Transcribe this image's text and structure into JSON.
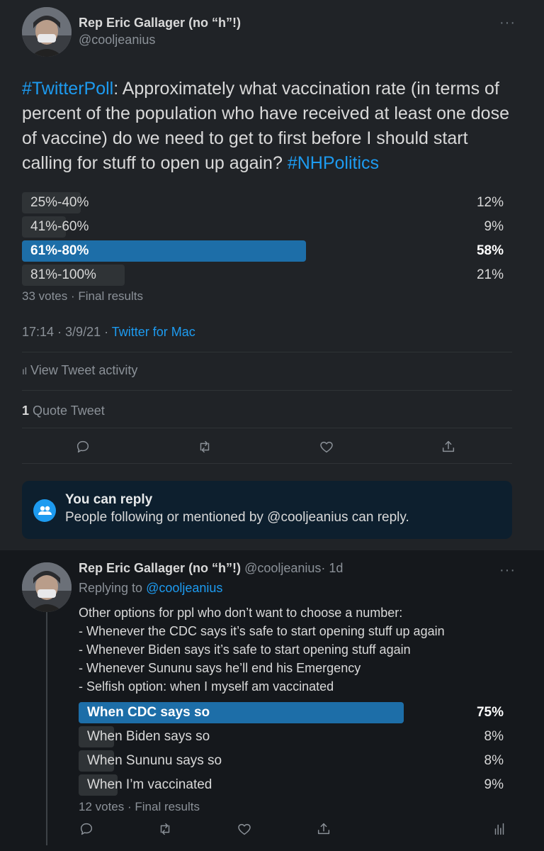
{
  "tweet": {
    "author_name": "Rep Eric Gallager (no “h”!)",
    "handle": "@cooljeanius",
    "hashtag_start": "#TwitterPoll",
    "body": ": Approximately what vaccination rate (in terms of percent of the population who have received at least one dose of vaccine) do we need to get to first before I should start calling for stuff to open up again?",
    "hashtag_end": "#NHPolitics",
    "poll": {
      "options": [
        {
          "label": "25%-40%",
          "percent": "12%",
          "value": 12,
          "winner": false
        },
        {
          "label": "41%-60%",
          "percent": "9%",
          "value": 9,
          "winner": false
        },
        {
          "label": "61%-80%",
          "percent": "58%",
          "value": 58,
          "winner": true
        },
        {
          "label": "81%-100%",
          "percent": "21%",
          "value": 21,
          "winner": false
        }
      ],
      "footer": "33 votes · Final results"
    },
    "time": "17:14 · 3/9/21 · ",
    "source": "Twitter for Mac",
    "activity_label": "View Tweet activity",
    "quote_count": "1",
    "quote_label": " Quote Tweet",
    "actions": [
      "reply-icon",
      "retweet-icon",
      "like-icon",
      "share-icon"
    ]
  },
  "reply_notice": {
    "title": "You can reply",
    "text": "People following or mentioned by @cooljeanius can reply.",
    "icon": "people-icon",
    "colors": {
      "background": "#0d1f2e",
      "icon": "#1d9bf0"
    }
  },
  "reply": {
    "author_name": "Rep Eric Gallager (no “h”!)",
    "handle": "@cooljeanius",
    "time": "· 1d",
    "replying_prefix": "Replying to ",
    "replying_to": "@cooljeanius",
    "lines": [
      "Other options for ppl who don’t want to choose a number:",
      "- Whenever the CDC says it’s safe to start opening stuff up again",
      "- Whenever Biden says it’s safe to start opening stuff again",
      "- Whenever Sununu says he’ll end his Emergency",
      "- Selfish option: when I myself am vaccinated"
    ],
    "poll": {
      "options": [
        {
          "label": "When CDC says so",
          "percent": "75%",
          "value": 75,
          "winner": true
        },
        {
          "label": "When Biden says so",
          "percent": "8%",
          "value": 8,
          "winner": false
        },
        {
          "label": "When Sununu says so",
          "percent": "8%",
          "value": 8,
          "winner": false
        },
        {
          "label": "When I’m vaccinated",
          "percent": "9%",
          "value": 9,
          "winner": false
        }
      ],
      "footer": "12 votes · Final results"
    },
    "actions": [
      "reply-icon",
      "retweet-icon",
      "like-icon",
      "share-icon",
      "analytics-icon"
    ]
  },
  "colors": {
    "accent": "#1d9bf0",
    "winner_bar": "#1d6ea8",
    "bar": "#2f3336"
  }
}
